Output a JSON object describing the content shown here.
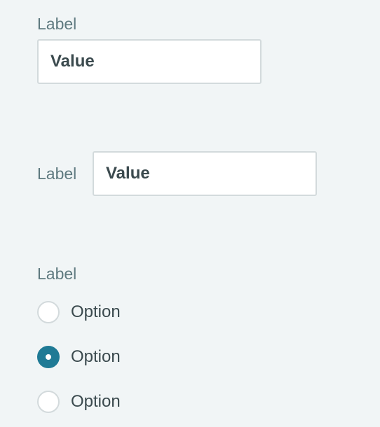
{
  "stacked_field": {
    "label": "Label",
    "value": "Value"
  },
  "inline_field": {
    "label": "Label",
    "value": "Value"
  },
  "radio_group": {
    "label": "Label",
    "options": [
      {
        "label": "Option",
        "selected": false
      },
      {
        "label": "Option",
        "selected": true
      },
      {
        "label": "Option",
        "selected": false
      }
    ]
  },
  "colors": {
    "background": "#f1f5f6",
    "label_text": "#5f7a80",
    "value_text": "#3b4a4e",
    "border": "#d3dadc",
    "accent": "#1f7a95"
  }
}
